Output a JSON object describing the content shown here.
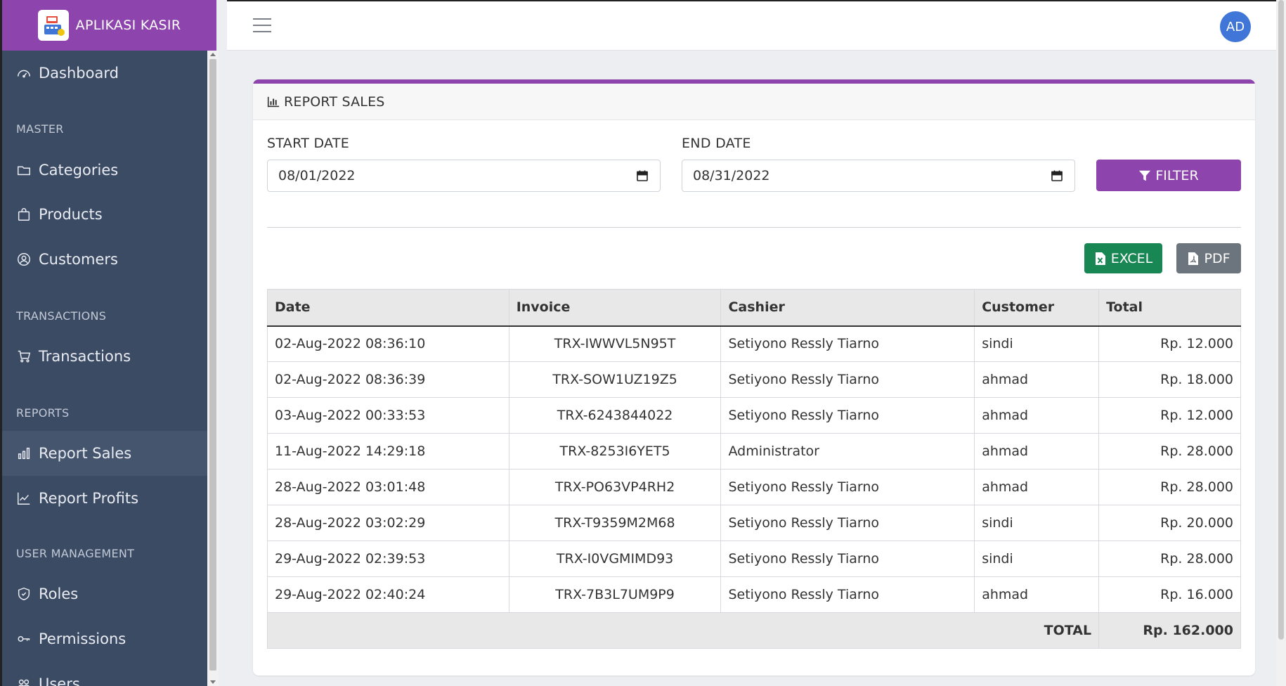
{
  "app": {
    "title": "APLIKASI KASIR",
    "logo_icon": "cash-register-icon"
  },
  "sidebar": {
    "items": [
      {
        "key": "dashboard",
        "label": "Dashboard",
        "icon": "speedometer-icon"
      },
      {
        "key": "master_title",
        "label": "MASTER"
      },
      {
        "key": "categories",
        "label": "Categories",
        "icon": "folder-icon"
      },
      {
        "key": "products",
        "label": "Products",
        "icon": "shopping-bag-icon"
      },
      {
        "key": "customers",
        "label": "Customers",
        "icon": "user-circle-icon"
      },
      {
        "key": "transactions_title",
        "label": "TRANSACTIONS"
      },
      {
        "key": "transactions",
        "label": "Transactions",
        "icon": "cart-icon"
      },
      {
        "key": "reports_title",
        "label": "REPORTS"
      },
      {
        "key": "report_sales",
        "label": "Report Sales",
        "icon": "bar-chart-icon",
        "active": true
      },
      {
        "key": "report_profits",
        "label": "Report Profits",
        "icon": "line-chart-icon"
      },
      {
        "key": "user_title",
        "label": "USER MANAGEMENT"
      },
      {
        "key": "roles",
        "label": "Roles",
        "icon": "shield-icon"
      },
      {
        "key": "permissions",
        "label": "Permissions",
        "icon": "key-icon"
      },
      {
        "key": "users",
        "label": "Users",
        "icon": "users-icon"
      }
    ]
  },
  "header": {
    "avatar_initials": "AD"
  },
  "card": {
    "title": "REPORT SALES",
    "start_date_label": "START DATE",
    "start_date_value": "08/01/2022",
    "end_date_label": "END DATE",
    "end_date_value": "08/31/2022",
    "filter_label": "FILTER",
    "excel_label": "EXCEL",
    "pdf_label": "PDF"
  },
  "table": {
    "columns": [
      "Date",
      "Invoice",
      "Cashier",
      "Customer",
      "Total"
    ],
    "rows": [
      [
        "02-Aug-2022 08:36:10",
        "TRX-IWWVL5N95T",
        "Setiyono Ressly Tiarno",
        "sindi",
        "Rp. 12.000"
      ],
      [
        "02-Aug-2022 08:36:39",
        "TRX-SOW1UZ19Z5",
        "Setiyono Ressly Tiarno",
        "ahmad",
        "Rp. 18.000"
      ],
      [
        "03-Aug-2022 00:33:53",
        "TRX-6243844022",
        "Setiyono Ressly Tiarno",
        "ahmad",
        "Rp. 12.000"
      ],
      [
        "11-Aug-2022 14:29:18",
        "TRX-8253I6YET5",
        "Administrator",
        "ahmad",
        "Rp. 28.000"
      ],
      [
        "28-Aug-2022 03:01:48",
        "TRX-PO63VP4RH2",
        "Setiyono Ressly Tiarno",
        "ahmad",
        "Rp. 28.000"
      ],
      [
        "28-Aug-2022 03:02:29",
        "TRX-T9359M2M68",
        "Setiyono Ressly Tiarno",
        "sindi",
        "Rp. 20.000"
      ],
      [
        "29-Aug-2022 02:39:53",
        "TRX-I0VGMIMD93",
        "Setiyono Ressly Tiarno",
        "sindi",
        "Rp. 28.000"
      ],
      [
        "29-Aug-2022 02:40:24",
        "TRX-7B3L7UM9P9",
        "Setiyono Ressly Tiarno",
        "ahmad",
        "Rp. 16.000"
      ]
    ],
    "total_label": "TOTAL",
    "total_value": "Rp. 162.000"
  },
  "colors": {
    "brand": "#8e44ad",
    "sidebar": "#3c4b64",
    "excel": "#198754",
    "pdf": "#6c757d",
    "avatar": "#3f76d8"
  }
}
